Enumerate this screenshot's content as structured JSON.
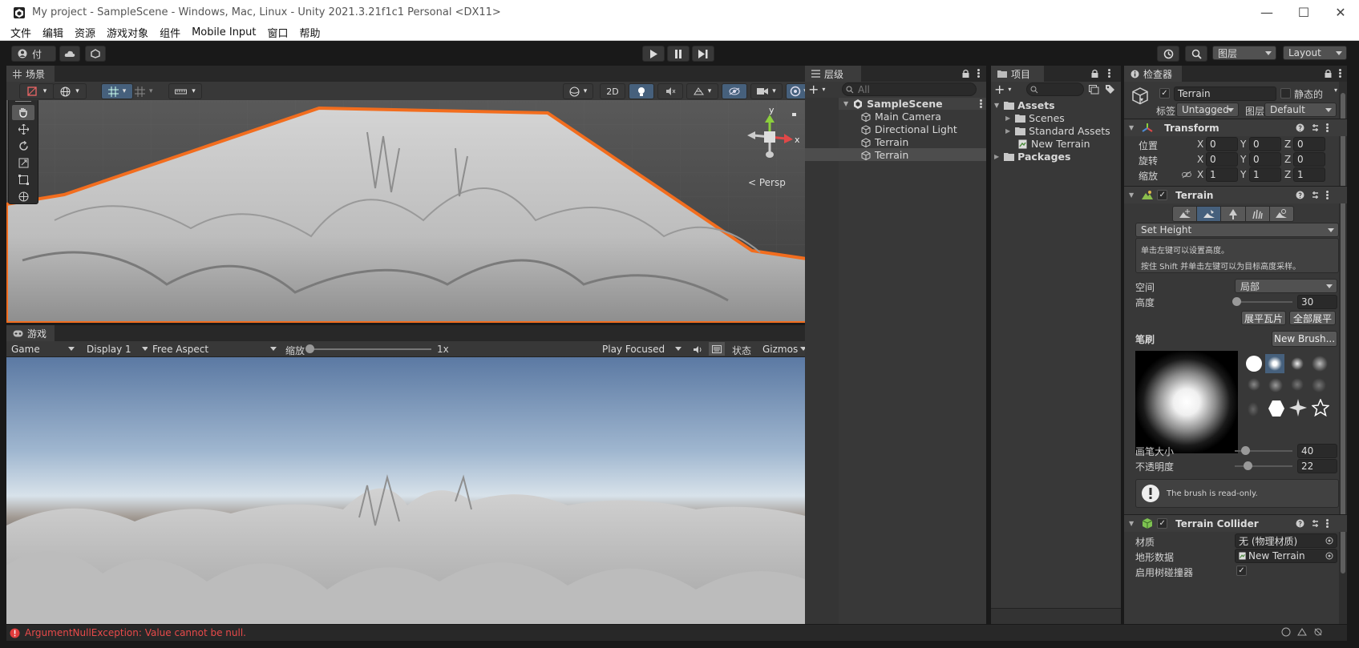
{
  "window": {
    "title": "My project - SampleScene - Windows, Mac, Linux - Unity 2021.3.21f1c1 Personal <DX11>",
    "min": "—",
    "max": "☐",
    "close": "✕"
  },
  "menu": [
    "文件",
    "编辑",
    "资源",
    "游戏对象",
    "组件",
    "Mobile Input",
    "窗口",
    "帮助"
  ],
  "toolbar": {
    "account": "付",
    "layers": "图层",
    "layout": "Layout"
  },
  "scene": {
    "tab": "场景",
    "mode_2d": "2D",
    "persp_label": "< Persp",
    "gizmo_y": "y",
    "gizmo_x": "x"
  },
  "game": {
    "tab": "游戏",
    "display_mode": "Game",
    "display": "Display 1",
    "aspect": "Free Aspect",
    "scale_label": "缩放",
    "scale_value": "1x",
    "scale_level": 0.0,
    "play_mode": "Play Focused",
    "stats": "状态",
    "gizmos": "Gizmos"
  },
  "hierarchy": {
    "tab": "层级",
    "search_placeholder": "All",
    "scene_name": "SampleScene",
    "items": [
      "Main Camera",
      "Directional Light",
      "Terrain",
      "Terrain"
    ]
  },
  "project": {
    "tab": "项目",
    "assets": "Assets",
    "items": [
      "Scenes",
      "Standard Assets",
      "New Terrain"
    ],
    "packages": "Packages"
  },
  "inspector": {
    "tab": "检查器",
    "object_name": "Terrain",
    "static_label": "静态的",
    "tag_label": "标签",
    "tag_value": "Untagged",
    "layer_label": "图层",
    "layer_value": "Default",
    "transform": {
      "title": "Transform",
      "rows": [
        {
          "label": "位置",
          "x": "0",
          "y": "0",
          "z": "0"
        },
        {
          "label": "旋转",
          "x": "0",
          "y": "0",
          "z": "0"
        },
        {
          "label": "缩放",
          "x": "1",
          "y": "1",
          "z": "1"
        }
      ],
      "axis_x": "X",
      "axis_y": "Y",
      "axis_z": "Z"
    },
    "terrain": {
      "title": "Terrain",
      "tool": "Set Height",
      "help_line1": "单击左键可以设置高度。",
      "help_line2": "按住 Shift 并单击左键可以为目标高度采样。",
      "space_label": "空间",
      "space_value": "局部",
      "height_label": "高度",
      "height_value": "30",
      "height_level": 0.03,
      "flatten_tile": "展平瓦片",
      "flatten_all": "全部展平",
      "brushes_label": "笔刷",
      "new_brush": "New Brush...",
      "brush_size_label": "画笔大小",
      "brush_size_value": "40",
      "brush_size_level": 0.18,
      "opacity_label": "不透明度",
      "opacity_value": "22",
      "opacity_level": 0.22,
      "readonly_msg": "The brush is read-only."
    },
    "collider": {
      "title": "Terrain Collider",
      "material_label": "材质",
      "material_value": "无 (物理材质)",
      "data_label": "地形数据",
      "data_value": "New Terrain",
      "trees_label": "启用树碰撞器"
    }
  },
  "status": {
    "error": "ArgumentNullException: Value cannot be null."
  }
}
